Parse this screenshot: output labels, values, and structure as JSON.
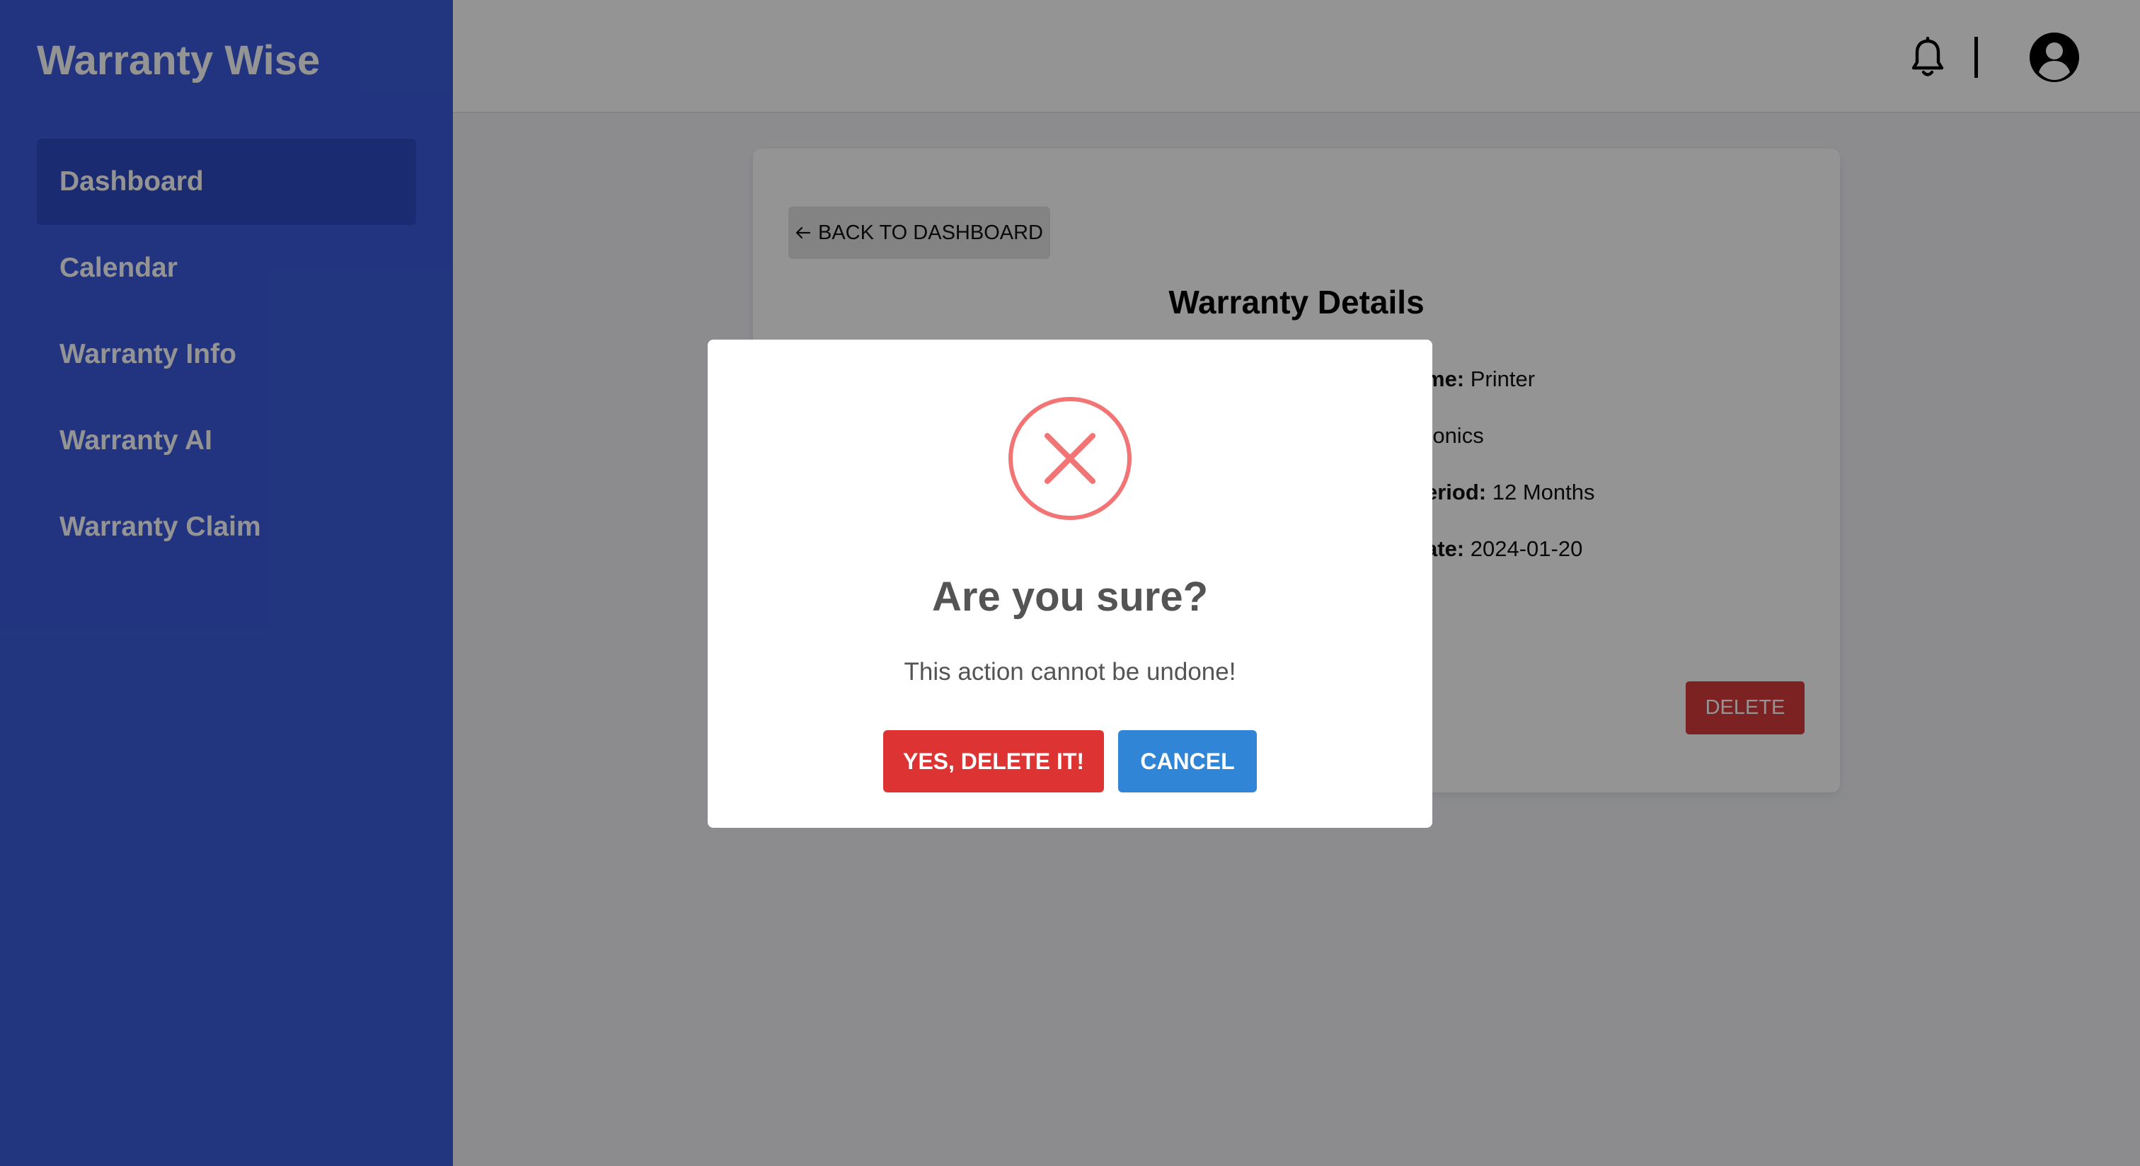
{
  "app": {
    "brand": "Warranty Wise"
  },
  "sidebar": {
    "items": [
      {
        "label": "Dashboard",
        "active": true
      },
      {
        "label": "Calendar",
        "active": false
      },
      {
        "label": "Warranty Info",
        "active": false
      },
      {
        "label": "Warranty AI",
        "active": false
      },
      {
        "label": "Warranty Claim",
        "active": false
      }
    ]
  },
  "topbar": {
    "icons": [
      "bell-icon",
      "account-circle-icon"
    ]
  },
  "details": {
    "back_label": "BACK TO DASHBOARD",
    "title": "Warranty Details",
    "rows": [
      {
        "label": "me:",
        "value": " Printer"
      },
      {
        "label": "",
        "value": "ronics"
      },
      {
        "label": "eriod:",
        "value": " 12 Months"
      },
      {
        "label": "ate:",
        "value": " 2024-01-20"
      }
    ],
    "delete_label": "DELETE"
  },
  "modal": {
    "icon": "error-x-circle-icon",
    "title": "Are you sure?",
    "text": "This action cannot be undone!",
    "confirm_label": "YES, DELETE IT!",
    "cancel_label": "CANCEL"
  },
  "colors": {
    "sidebar": "#3b5bdb",
    "sidebar_active": "#2f4ac4",
    "confirm": "#dd3333",
    "cancel": "#3085d6",
    "delete": "#d63c3c",
    "error_icon": "#f27474"
  }
}
